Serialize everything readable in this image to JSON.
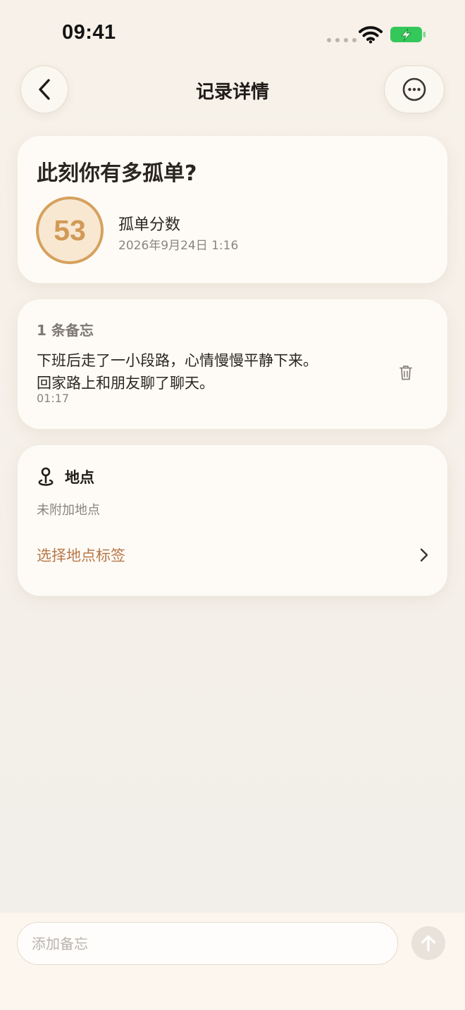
{
  "status_bar": {
    "time": "09:41"
  },
  "header": {
    "title": "记录详情"
  },
  "score_card": {
    "question": "此刻你有多孤单?",
    "score": "53",
    "label": "孤单分数",
    "date": "2026年9月24日 1:16"
  },
  "notes_card": {
    "count_label": "1 条备忘",
    "notes": [
      {
        "line1": "下班后走了一小段路，心情慢慢平静下来。",
        "line2": "回家路上和朋友聊了聊天。",
        "time": "01:17"
      }
    ]
  },
  "location_card": {
    "title": "地点",
    "empty_text": "未附加地点",
    "select_label": "选择地点标签"
  },
  "input_bar": {
    "placeholder": "添加备忘"
  },
  "colors": {
    "accent": "#d19a57",
    "link": "#b87748",
    "battery": "#34c759"
  }
}
